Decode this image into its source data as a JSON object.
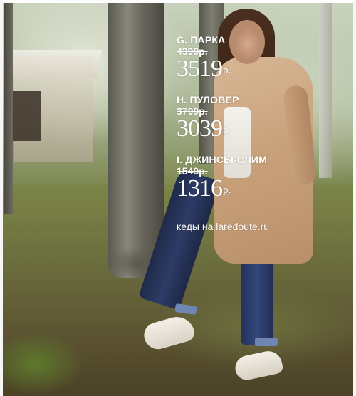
{
  "overlay": {
    "items": [
      {
        "name": "G. ПАРКА",
        "old_price": "4399р.",
        "new_price": "3519",
        "currency": "р."
      },
      {
        "name": "H. ПУЛОВЕР",
        "old_price": "3799р.",
        "new_price": "3039",
        "currency": "р."
      },
      {
        "name": "I. ДЖИНСЫ-СЛИМ",
        "old_price": "1549р.",
        "new_price": "1316",
        "currency": "р."
      }
    ],
    "credit": "кеды на laredoute.ru"
  },
  "colors": {
    "text": "#ffffff",
    "coat": "#c9a27c",
    "jeans": "#2d3c66"
  }
}
